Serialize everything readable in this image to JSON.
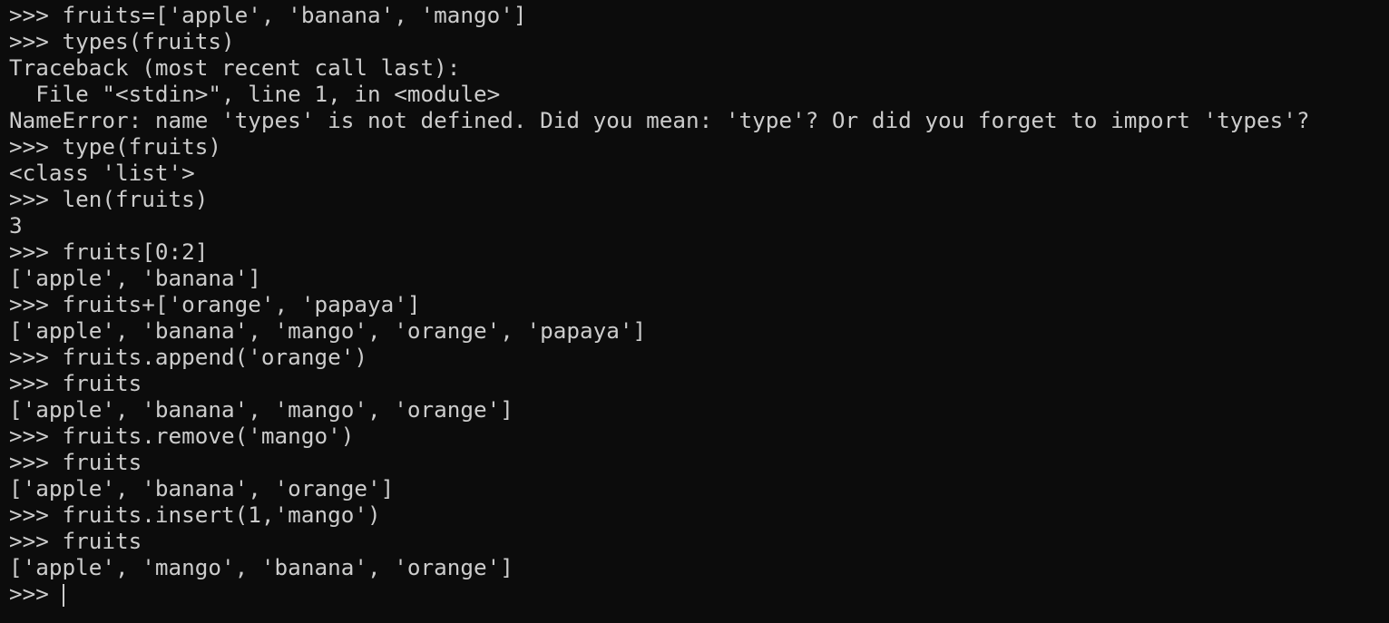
{
  "terminal": {
    "clipped_line": ">>> fruits=['apple', 'banana', 'mango']",
    "lines": [
      ">>> fruits=['apple', 'banana', 'mango']",
      ">>> types(fruits)",
      "Traceback (most recent call last):",
      "  File \"<stdin>\", line 1, in <module>",
      "NameError: name 'types' is not defined. Did you mean: 'type'? Or did you forget to import 'types'?",
      ">>> type(fruits)",
      "<class 'list'>",
      ">>> len(fruits)",
      "3",
      ">>> fruits[0:2]",
      "['apple', 'banana']",
      ">>> fruits+['orange', 'papaya']",
      "['apple', 'banana', 'mango', 'orange', 'papaya']",
      ">>> fruits.append('orange')",
      ">>> fruits",
      "['apple', 'banana', 'mango', 'orange']",
      ">>> fruits.remove('mango')",
      ">>> fruits",
      "['apple', 'banana', 'orange']",
      ">>> fruits.insert(1,'mango')",
      ">>> fruits",
      "['apple', 'mango', 'banana', 'orange']"
    ],
    "prompt": ">>> ",
    "colors": {
      "background": "#0c0c0c",
      "foreground": "#cccccc"
    }
  }
}
